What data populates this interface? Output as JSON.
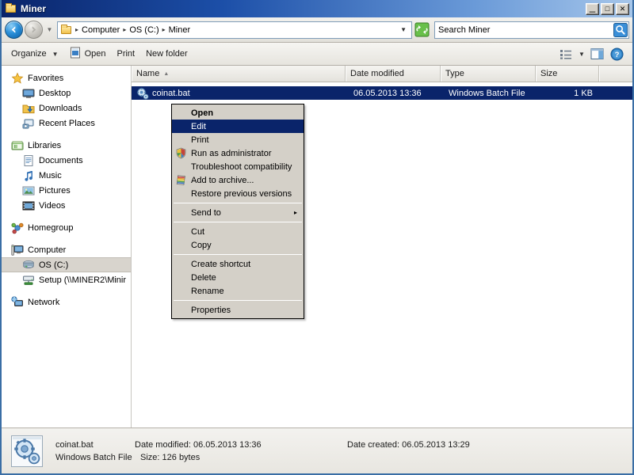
{
  "window": {
    "title": "Miner",
    "icon": "folder-icon",
    "buttons": {
      "minimize": "_",
      "maximize": "□",
      "close": "✕"
    }
  },
  "navbar": {
    "back_icon": "back-arrow-icon",
    "forward_icon": "forward-arrow-icon",
    "history_caret": "▼",
    "breadcrumb_icon": "folder-icon",
    "breadcrumbs": [
      "Computer",
      "OS (C:)",
      "Miner"
    ],
    "separator": "▸",
    "address_caret": "▼",
    "refresh_icon": "refresh-icon",
    "search": {
      "value": "Search Miner",
      "placeholder": "Search Miner",
      "icon": "search-icon"
    }
  },
  "toolbar": {
    "organize_label": "Organize",
    "organize_caret": "▼",
    "open_label": "Open",
    "open_icon": "open-file-icon",
    "print_label": "Print",
    "new_folder_label": "New folder",
    "view_icon": "view-list-icon",
    "view_caret": "▼",
    "preview_pane_icon": "preview-pane-icon",
    "help_icon": "help-icon"
  },
  "sidebar": {
    "groups": [
      {
        "header": {
          "label": "Favorites",
          "icon": "star-icon"
        },
        "items": [
          {
            "label": "Desktop",
            "icon": "desktop-icon"
          },
          {
            "label": "Downloads",
            "icon": "downloads-icon"
          },
          {
            "label": "Recent Places",
            "icon": "recent-places-icon"
          }
        ]
      },
      {
        "header": {
          "label": "Libraries",
          "icon": "libraries-icon"
        },
        "items": [
          {
            "label": "Documents",
            "icon": "documents-icon"
          },
          {
            "label": "Music",
            "icon": "music-icon"
          },
          {
            "label": "Pictures",
            "icon": "pictures-icon"
          },
          {
            "label": "Videos",
            "icon": "videos-icon"
          }
        ]
      },
      {
        "header": {
          "label": "Homegroup",
          "icon": "homegroup-icon"
        },
        "items": []
      },
      {
        "header": {
          "label": "Computer",
          "icon": "computer-icon"
        },
        "items": [
          {
            "label": "OS (C:)",
            "icon": "harddisk-icon",
            "selected": true
          },
          {
            "label": "Setup (\\\\MINER2\\Minir",
            "icon": "network-drive-icon"
          }
        ]
      },
      {
        "header": {
          "label": "Network",
          "icon": "network-icon"
        },
        "items": []
      }
    ]
  },
  "filelist": {
    "columns": [
      {
        "label": "Name",
        "sorted": true,
        "sort_arrow": "▲"
      },
      {
        "label": "Date modified"
      },
      {
        "label": "Type"
      },
      {
        "label": "Size"
      }
    ],
    "rows": [
      {
        "name": "coinat.bat",
        "icon": "batch-file-icon",
        "date_modified": "06.05.2013 13:36",
        "type": "Windows Batch File",
        "size": "1 KB",
        "selected": true
      }
    ]
  },
  "context_menu": {
    "items": [
      {
        "label": "Open",
        "bold": true
      },
      {
        "label": "Edit",
        "highlighted": true
      },
      {
        "label": "Print"
      },
      {
        "label": "Run as administrator",
        "icon": "shield-icon"
      },
      {
        "label": "Troubleshoot compatibility"
      },
      {
        "label": "Add to archive...",
        "icon": "archive-icon"
      },
      {
        "label": "Restore previous versions"
      },
      {
        "separator": true
      },
      {
        "label": "Send to",
        "submenu": true,
        "arrow": "▸"
      },
      {
        "separator": true
      },
      {
        "label": "Cut"
      },
      {
        "label": "Copy"
      },
      {
        "separator": true
      },
      {
        "label": "Create shortcut"
      },
      {
        "label": "Delete"
      },
      {
        "label": "Rename"
      },
      {
        "separator": true
      },
      {
        "label": "Properties"
      }
    ]
  },
  "details_pane": {
    "icon": "batch-file-large-icon",
    "file_name": "coinat.bat",
    "file_type": "Windows Batch File",
    "date_modified_label": "Date modified:",
    "date_modified_value": "06.05.2013 13:36",
    "date_created_label": "Date created:",
    "date_created_value": "06.05.2013 13:29",
    "size_label": "Size:",
    "size_value": "126 bytes"
  },
  "colors": {
    "title_gradient_start": "#0a246a",
    "title_gradient_end": "#a6c6ea",
    "selection_blue": "#0a246a",
    "chrome_gray": "#d4d0c8",
    "frame_border": "#3a6ea5"
  }
}
